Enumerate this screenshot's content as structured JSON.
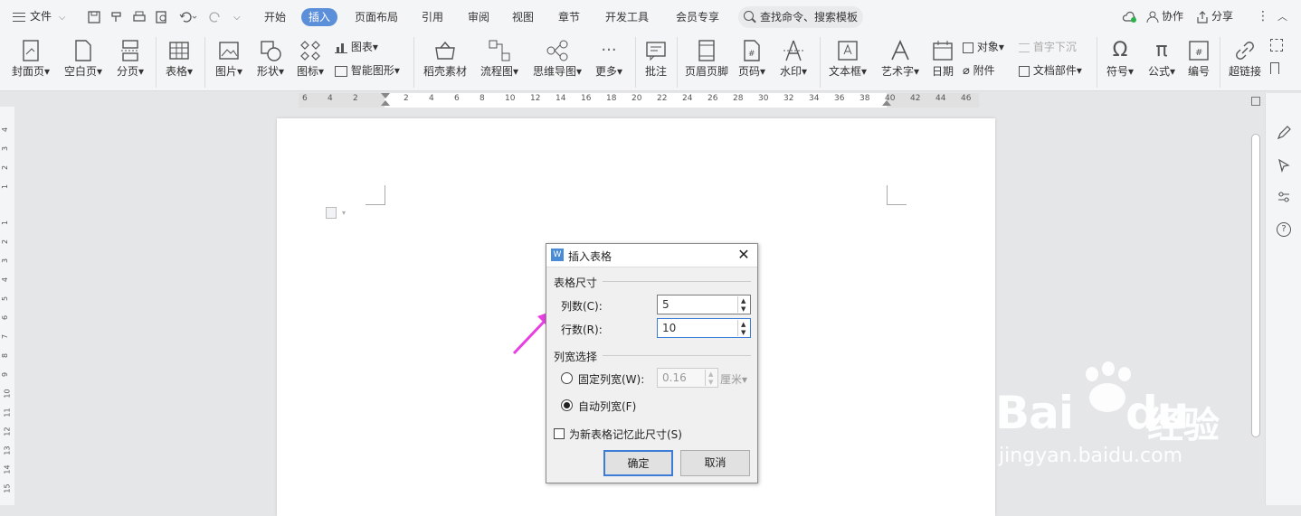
{
  "menubar": {
    "file": "文件",
    "tabs": [
      "开始",
      "插入",
      "页面布局",
      "引用",
      "审阅",
      "视图",
      "章节",
      "开发工具",
      "会员专享"
    ],
    "active_tab": "插入",
    "search_placeholder": "查找命令、搜索模板",
    "collab": "协作",
    "share": "分享"
  },
  "ribbon": {
    "cover": "封面页",
    "blank": "空白页",
    "pagebreak": "分页",
    "table": "表格",
    "picture": "图片",
    "shape": "形状",
    "icon": "图标",
    "chart": "图表",
    "smartart": "智能图形",
    "material": "稻壳素材",
    "flowchart": "流程图",
    "mindmap": "思维导图",
    "more": "更多",
    "comment": "批注",
    "header_footer": "页眉页脚",
    "page_num": "页码",
    "watermark": "水印",
    "textbox": "文本框",
    "wordart": "艺术字",
    "date": "日期",
    "object": "对象",
    "attachment": "附件",
    "dropcap": "首字下沉",
    "docparts": "文档部件",
    "symbol": "符号",
    "formula": "公式",
    "numbering": "编号",
    "hyperlink": "超链接"
  },
  "ruler": {
    "h": [
      "6",
      "4",
      "2",
      "2",
      "4",
      "6",
      "8",
      "10",
      "12",
      "14",
      "16",
      "18",
      "20",
      "22",
      "24",
      "26",
      "28",
      "30",
      "32",
      "34",
      "36",
      "38",
      "40",
      "42",
      "44",
      "46"
    ],
    "v": [
      "1",
      "2",
      "3",
      "4",
      "1",
      "2",
      "3",
      "4",
      "5",
      "6",
      "7",
      "8",
      "9",
      "10",
      "11",
      "12",
      "13",
      "14",
      "15"
    ]
  },
  "dialog": {
    "title": "插入表格",
    "size_group": "表格尺寸",
    "cols_label": "列数(C):",
    "cols_value": "5",
    "rows_label": "行数(R):",
    "rows_value": "10",
    "width_group": "列宽选择",
    "fixed_label": "固定列宽(W):",
    "fixed_value": "0.16",
    "unit": "厘米",
    "auto_label": "自动列宽(F)",
    "remember_label": "为新表格记忆此尺寸(S)",
    "ok": "确定",
    "cancel": "取消"
  },
  "watermark": {
    "brand": "Bai",
    "brand2": "du",
    "cn": "经验",
    "url": "jingyan.baidu.com"
  },
  "colors": {
    "accent": "#5b8fd9",
    "arrow": "#e83fe3"
  }
}
